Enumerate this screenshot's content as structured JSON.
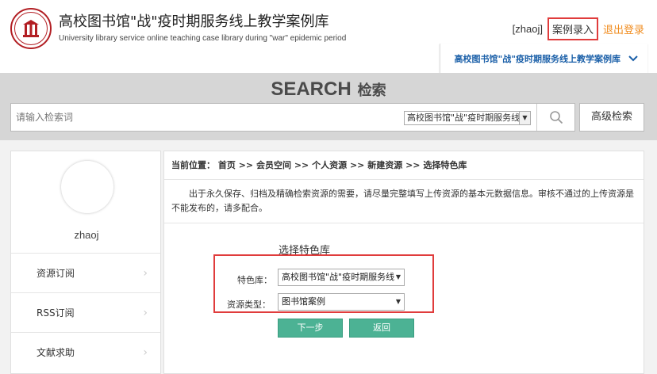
{
  "header": {
    "title": "高校图书馆\"战\"疫时期服务线上教学案例库",
    "subtitle": "University library service online teaching case library during \"war\" epidemic period",
    "username": "[zhaoj]",
    "case_entry": "案例录入",
    "logout": "退出登录",
    "library_selector": "高校图书馆\"战\"疫时期服务线上教学案例库"
  },
  "search": {
    "title_en": "SEARCH",
    "title_cn": "检索",
    "placeholder": "请输入检索词",
    "scope": "高校图书馆\"战\"疫时期服务线",
    "advanced": "高级检索"
  },
  "sidebar": {
    "username": "zhaoj",
    "items": [
      {
        "label": "资源订阅"
      },
      {
        "label": "RSS订阅"
      },
      {
        "label": "文献求助"
      }
    ]
  },
  "main": {
    "breadcrumb": {
      "prefix": "当前位置：",
      "items": [
        "首页",
        ">>",
        "会员空间",
        ">>",
        "个人资源",
        ">>",
        "新建资源",
        ">>",
        "选择特色库"
      ]
    },
    "notice": "出于永久保存、归档及精确检索资源的需要，请尽量完整填写上传资源的基本元数据信息。审核不通过的上传资源是不能发布的，请多配合。",
    "section_label": "选择特色库",
    "form": {
      "library_label": "特色库：",
      "library_value": "高校图书馆\"战\"疫时期服务线",
      "type_label": "资源类型：",
      "type_value": "图书馆案例"
    },
    "next_button": "下一步",
    "back_button": "返回"
  },
  "colors": {
    "accent_green": "#4cb294",
    "highlight_red": "#e03c3c",
    "logout_orange": "#f08c1f",
    "link_blue": "#1a5fa8"
  }
}
